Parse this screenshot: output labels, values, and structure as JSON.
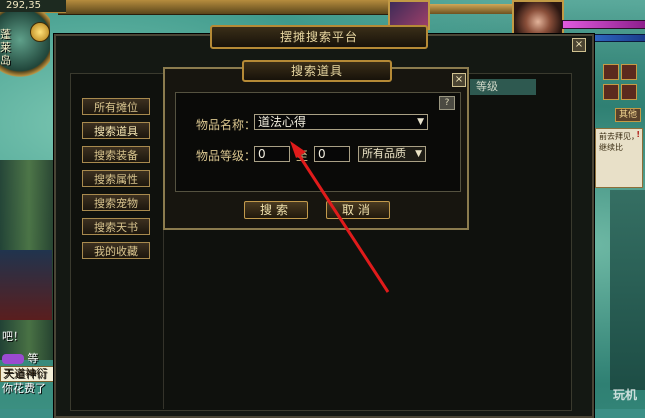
{
  "hud": {
    "coords": "292,35",
    "map_label": "蓬莱岛"
  },
  "right_panel": {
    "button": "其他",
    "notice_text": "前去拜见，继续比"
  },
  "chat": {
    "line1": "吧！",
    "line2": "等",
    "line3": "天道神衍",
    "line4": "你花费了"
  },
  "stall_window": {
    "title": "摆摊搜索平台",
    "close": "×",
    "column_header": "等级",
    "side_buttons": [
      "所有摊位",
      "搜索道具",
      "搜索装备",
      "搜索属性",
      "搜索宠物",
      "搜索天书",
      "我的收藏"
    ]
  },
  "search_dialog": {
    "title": "搜索道具",
    "close": "×",
    "help": "?",
    "item_name_label": "物品名称：",
    "item_name_value": "道法心得",
    "item_level_label": "物品等级：",
    "level_min": "0",
    "level_sep": "至",
    "level_max": "0",
    "quality_value": "所有品质",
    "search_button": "搜索",
    "cancel_button": "取消"
  },
  "watermark": "玩机"
}
